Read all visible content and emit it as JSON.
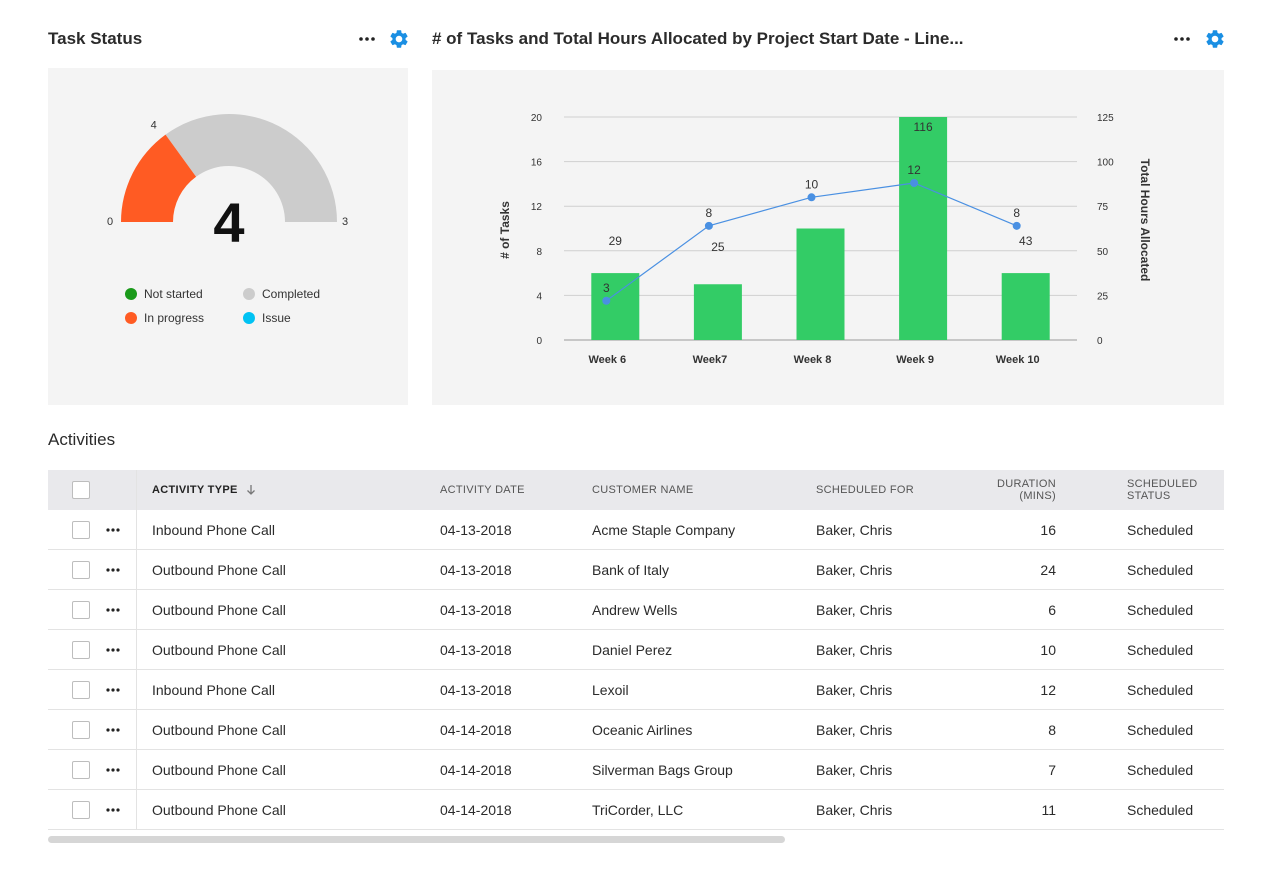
{
  "task_status": {
    "title": "Task Status",
    "gauge": {
      "value": 4,
      "display": "4",
      "min_label": "0",
      "max_label": "3",
      "marker_label": "4",
      "fraction": 0.3
    },
    "legend": [
      {
        "label": "Not started",
        "color": "#1a9a1a"
      },
      {
        "label": "Completed",
        "color": "#cccccc"
      },
      {
        "label": "In progress",
        "color": "#ff5b23"
      },
      {
        "label": "Issue",
        "color": "#00c2f3"
      }
    ],
    "colors": {
      "progress": "#ff5b23",
      "rest": "#cccccc"
    }
  },
  "chart_panel": {
    "title": "# of Tasks and Total Hours Allocated by Project Start Date - Line...",
    "left_axis_label": "# of Tasks",
    "right_axis_label": "Total Hours Allocated"
  },
  "chart_data": {
    "type": "bar",
    "categories": [
      "Week 6",
      "Week7",
      "Week 8",
      "Week 9",
      "Week 10"
    ],
    "series": [
      {
        "type": "bar",
        "axis": "left",
        "values": [
          6,
          5,
          10,
          20,
          6
        ],
        "labels": [
          "29",
          "",
          "",
          "116",
          "43"
        ],
        "color": "#33cc66"
      },
      {
        "type": "line",
        "axis": "right",
        "values": [
          22,
          64,
          80,
          88,
          64
        ],
        "labels": [
          "3",
          "8",
          "10",
          "12",
          "8"
        ],
        "color": "#4a90e2"
      }
    ],
    "extra_labels": [
      {
        "category": "Week7",
        "text": "25"
      }
    ],
    "y_left": {
      "min": 0,
      "max": 20,
      "ticks": [
        "0",
        "4",
        "8",
        "12",
        "16",
        "20"
      ]
    },
    "y_right": {
      "min": 0,
      "max": 125,
      "ticks": [
        "0",
        "25",
        "50",
        "75",
        "100",
        "125"
      ]
    },
    "xlabel": "",
    "ylabel": "# of Tasks",
    "y2label": "Total Hours Allocated",
    "grid": true
  },
  "activities": {
    "title": "Activities",
    "columns": [
      {
        "label": "ACTIVITY TYPE",
        "sortable": true
      },
      {
        "label": "ACTIVITY DATE"
      },
      {
        "label": "CUSTOMER NAME"
      },
      {
        "label": "SCHEDULED FOR"
      },
      {
        "label": "DURATION",
        "label2": "(MINS)"
      },
      {
        "label": "SCHEDULED",
        "label2": "STATUS"
      }
    ],
    "rows": [
      {
        "type": "Inbound Phone Call",
        "date": "04-13-2018",
        "customer": "Acme Staple Company",
        "scheduled_for": "Baker, Chris",
        "duration": "16",
        "status": "Scheduled"
      },
      {
        "type": "Outbound Phone Call",
        "date": "04-13-2018",
        "customer": "Bank of Italy",
        "scheduled_for": "Baker, Chris",
        "duration": "24",
        "status": "Scheduled"
      },
      {
        "type": "Outbound Phone Call",
        "date": "04-13-2018",
        "customer": "Andrew Wells",
        "scheduled_for": "Baker, Chris",
        "duration": "6",
        "status": "Scheduled"
      },
      {
        "type": "Outbound Phone Call",
        "date": "04-13-2018",
        "customer": "Daniel Perez",
        "scheduled_for": "Baker, Chris",
        "duration": "10",
        "status": "Scheduled"
      },
      {
        "type": "Inbound Phone Call",
        "date": "04-13-2018",
        "customer": "Lexoil",
        "scheduled_for": "Baker, Chris",
        "duration": "12",
        "status": "Scheduled"
      },
      {
        "type": "Outbound Phone Call",
        "date": "04-14-2018",
        "customer": "Oceanic Airlines",
        "scheduled_for": "Baker, Chris",
        "duration": "8",
        "status": "Scheduled"
      },
      {
        "type": "Outbound Phone Call",
        "date": "04-14-2018",
        "customer": "Silverman Bags Group",
        "scheduled_for": "Baker, Chris",
        "duration": "7",
        "status": "Scheduled"
      },
      {
        "type": "Outbound Phone Call",
        "date": "04-14-2018",
        "customer": "TriCorder, LLC",
        "scheduled_for": "Baker, Chris",
        "duration": "11",
        "status": "Scheduled"
      }
    ]
  },
  "icons": {
    "menu": "more-horizontal-icon",
    "settings": "gear-icon",
    "sort": "arrow-down-icon"
  },
  "accent": "#1a8fe3"
}
